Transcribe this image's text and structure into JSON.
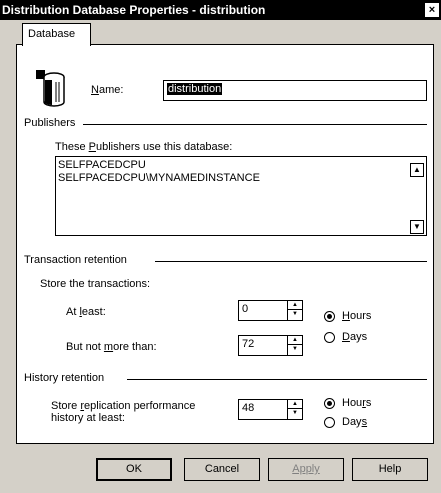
{
  "window": {
    "title": "Distribution Database Properties - distribution",
    "close_glyph": "×"
  },
  "tabs": [
    {
      "label": "Database"
    }
  ],
  "database": {
    "name_label_pre": "",
    "name_label_u": "N",
    "name_label_post": "ame:",
    "name_value": "distribution",
    "icon": "database-cylinder-icon"
  },
  "publishers": {
    "section_label": "Publishers",
    "list_label_pre": "These ",
    "list_label_u": "P",
    "list_label_post": "ublishers use this database:",
    "items": [
      "SELFPACEDCPU",
      "SELFPACEDCPU\\MYNAMEDINSTANCE"
    ]
  },
  "transaction_retention": {
    "section_label": "Transaction retention",
    "store_label": "Store the transactions:",
    "at_least_label_pre": "At ",
    "at_least_label_u": "l",
    "at_least_label_post": "east:",
    "at_least_value": "0",
    "not_more_label_pre": "But not ",
    "not_more_label_u": "m",
    "not_more_label_post": "ore than:",
    "not_more_value": "72",
    "unit_hours_pre": "",
    "unit_hours_u": "H",
    "unit_hours_post": "ours",
    "unit_days_pre": "",
    "unit_days_u": "D",
    "unit_days_post": "ays",
    "selected_unit": "Hours"
  },
  "history_retention": {
    "section_label": "History retention",
    "store_label_line1_pre": "Store ",
    "store_label_line1_u": "r",
    "store_label_line1_post": "eplication performance",
    "store_label_line2": "history at least:",
    "value": "48",
    "unit_hours_pre": "Hou",
    "unit_hours_u": "r",
    "unit_hours_post": "s",
    "unit_days_pre": "Day",
    "unit_days_u": "s",
    "unit_days_post": "",
    "selected_unit": "Hours"
  },
  "buttons": {
    "ok": "OK",
    "cancel": "Cancel",
    "apply": "Apply",
    "help": "Help"
  },
  "scroll": {
    "up_glyph": "▲",
    "down_glyph": "▼"
  }
}
